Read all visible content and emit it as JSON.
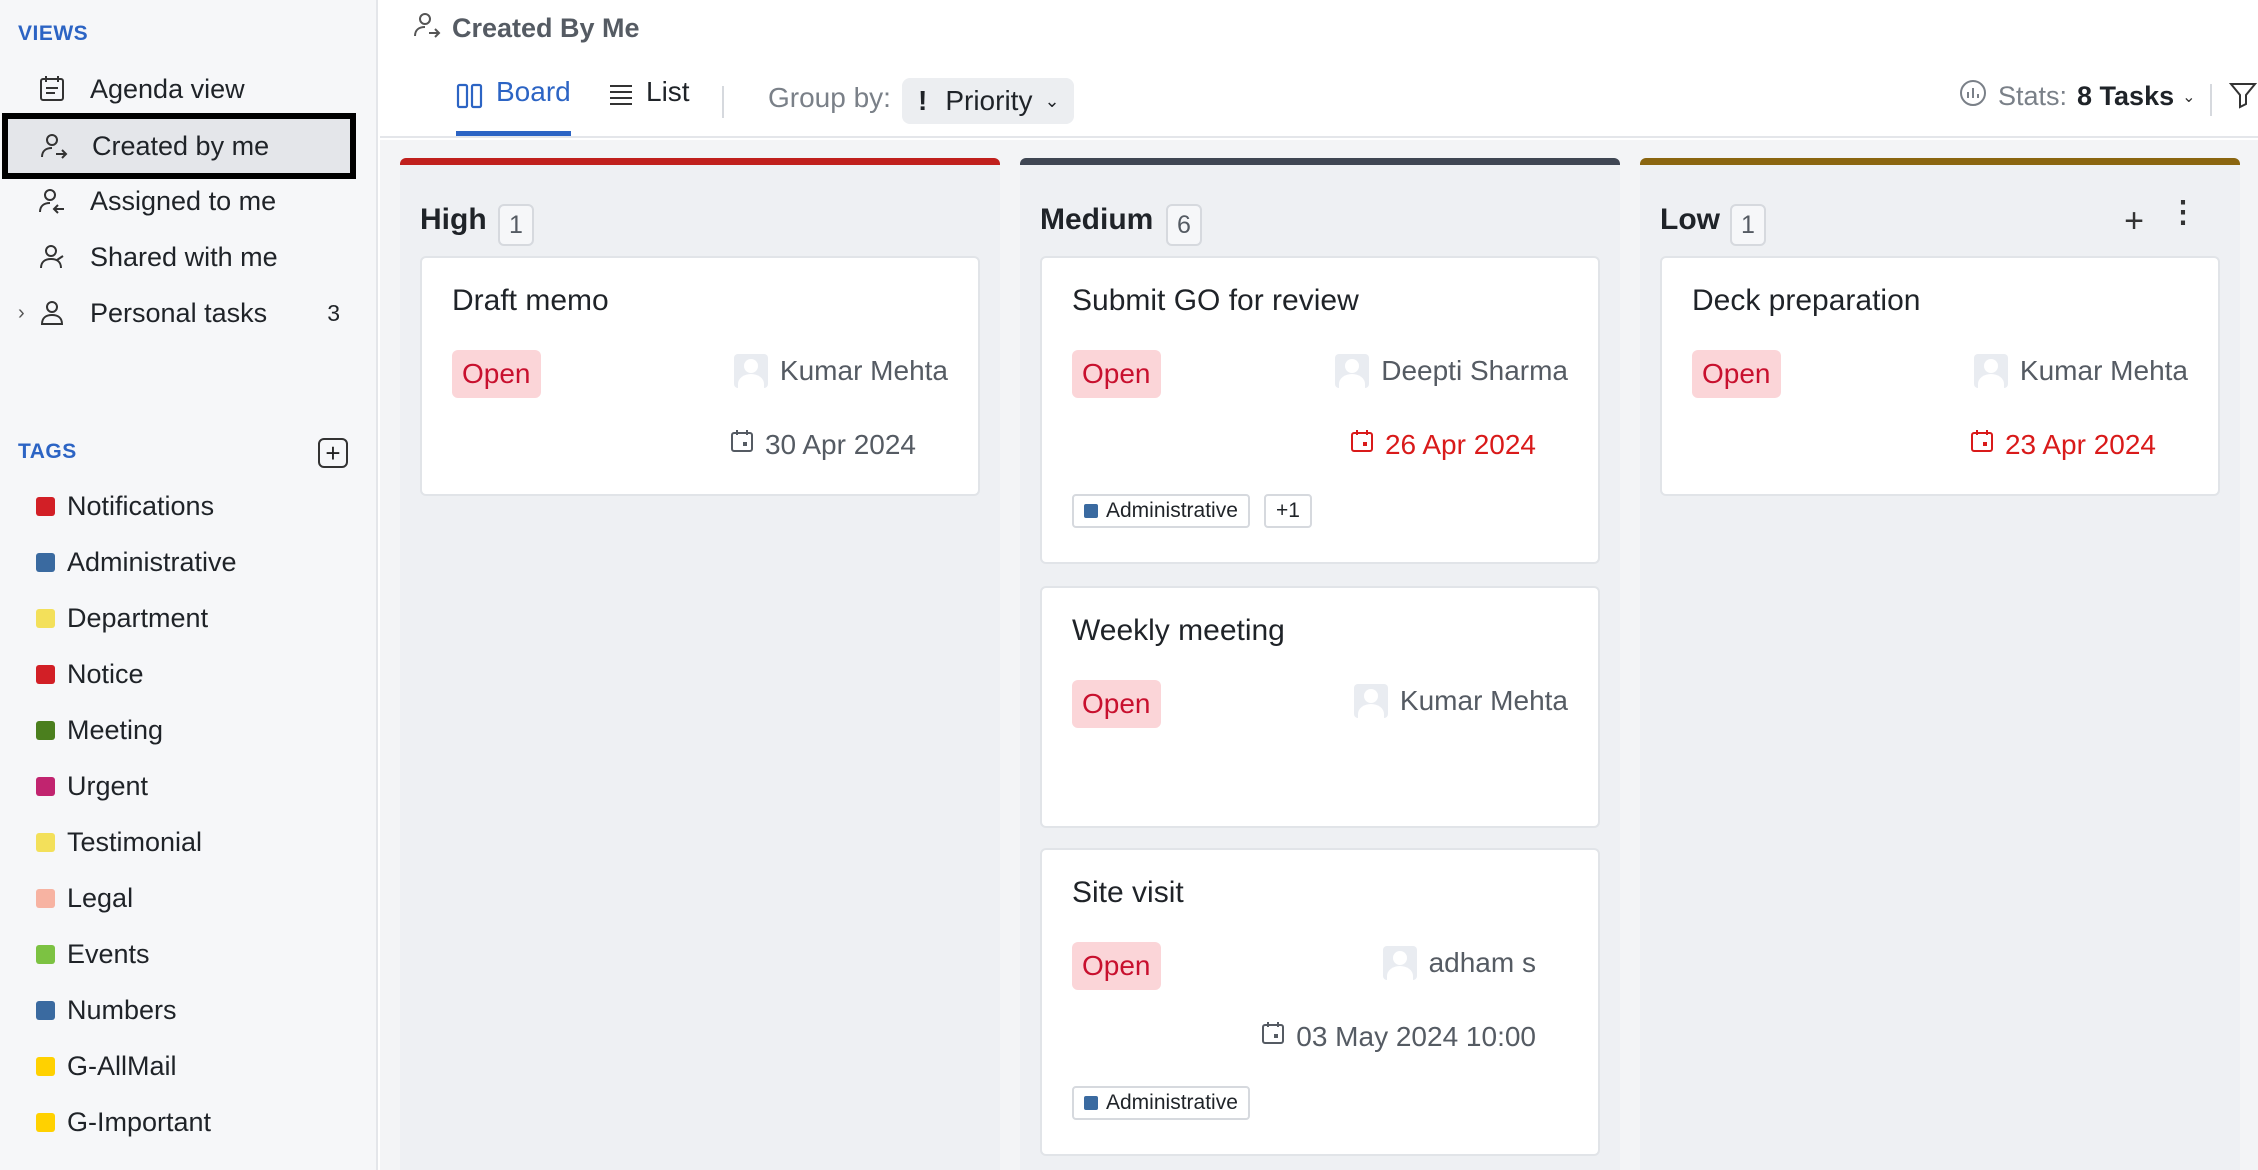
{
  "sidebar": {
    "views_title": "VIEWS",
    "views": [
      {
        "label": "Agenda view",
        "icon": "agenda-icon"
      },
      {
        "label": "Created by me",
        "icon": "user-arrow-icon",
        "selected": true
      },
      {
        "label": "Assigned to me",
        "icon": "user-assigned-icon"
      },
      {
        "label": "Shared with me",
        "icon": "user-shared-icon"
      },
      {
        "label": "Personal tasks",
        "icon": "user-icon",
        "count": "3"
      }
    ],
    "tags_title": "TAGS",
    "tags": [
      {
        "label": "Notifications",
        "color": "#d21f26"
      },
      {
        "label": "Administrative",
        "color": "#3a6aa0"
      },
      {
        "label": "Department",
        "color": "#f3e05a"
      },
      {
        "label": "Notice",
        "color": "#d21f26"
      },
      {
        "label": "Meeting",
        "color": "#4b7f1e"
      },
      {
        "label": "Urgent",
        "color": "#c1246f"
      },
      {
        "label": "Testimonial",
        "color": "#f3e05a"
      },
      {
        "label": "Legal",
        "color": "#f7b3a2"
      },
      {
        "label": "Events",
        "color": "#7cc242"
      },
      {
        "label": "Numbers",
        "color": "#3a6aa0"
      },
      {
        "label": "G-AllMail",
        "color": "#ffd100"
      },
      {
        "label": "G-Important",
        "color": "#ffd100"
      }
    ]
  },
  "header": {
    "title": "Created By Me",
    "tabs": [
      {
        "label": "Board",
        "active": true
      },
      {
        "label": "List",
        "active": false
      }
    ],
    "group_by_label": "Group by:",
    "group_by_value": "Priority",
    "stats_label": "Stats:",
    "stats_value": "8 Tasks"
  },
  "board": {
    "columns": [
      {
        "title": "High",
        "count": "1",
        "color": "#c0201d",
        "cards": [
          {
            "title": "Draft memo",
            "status": "Open",
            "assignee": "Kumar Mehta",
            "due": "30 Apr 2024",
            "overdue": false
          }
        ]
      },
      {
        "title": "Medium",
        "count": "6",
        "color": "#3f4653",
        "cards": [
          {
            "title": "Submit GO for review",
            "status": "Open",
            "assignee": "Deepti Sharma",
            "due": "26 Apr 2024",
            "overdue": true,
            "tag": "Administrative",
            "tag_color": "#3a6aa0",
            "more_tags": "+1"
          },
          {
            "title": "Weekly meeting",
            "status": "Open",
            "assignee": "Kumar Mehta"
          },
          {
            "title": "Site visit",
            "status": "Open",
            "assignee": "adham s",
            "due": "03 May 2024 10:00",
            "overdue": false,
            "tag": "Administrative",
            "tag_color": "#3a6aa0"
          }
        ]
      },
      {
        "title": "Low",
        "count": "1",
        "color": "#8a6510",
        "cards": [
          {
            "title": "Deck preparation",
            "status": "Open",
            "assignee": "Kumar Mehta",
            "due": "23 Apr 2024",
            "overdue": true
          }
        ]
      }
    ]
  }
}
